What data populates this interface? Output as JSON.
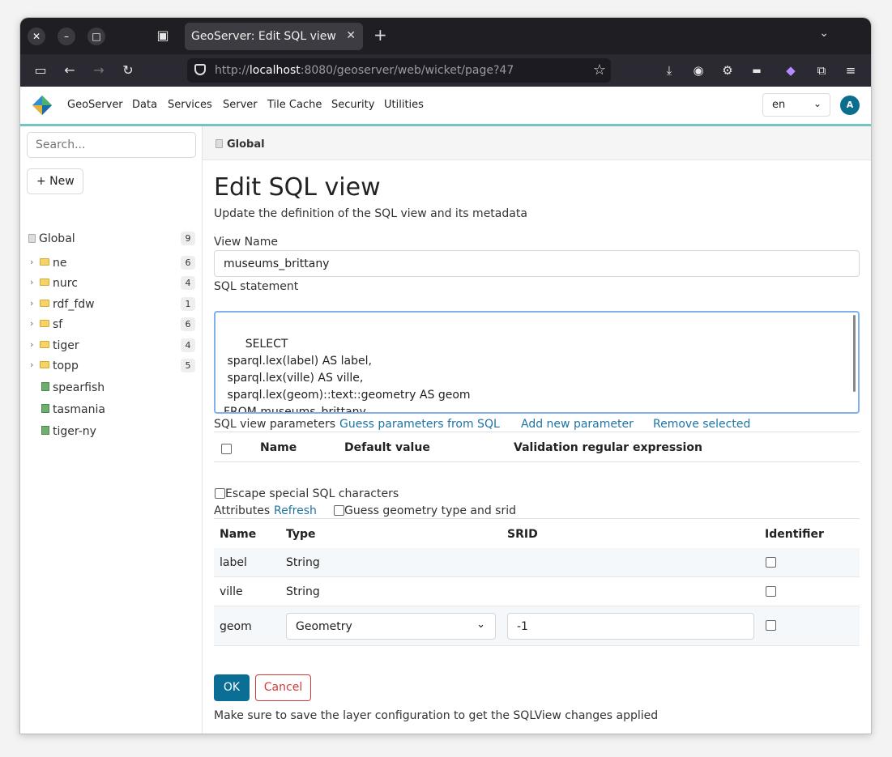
{
  "browser": {
    "tab_title": "GeoServer: Edit SQL view",
    "url_prefix": "http://",
    "url_host": "localhost",
    "url_rest": ":8080/geoserver/web/wicket/page?47"
  },
  "header": {
    "menu": [
      "GeoServer",
      "Data",
      "Services",
      "Server",
      "Tile Cache",
      "Security",
      "Utilities"
    ],
    "language": "en",
    "avatar": "A"
  },
  "sidebar": {
    "search_placeholder": "Search...",
    "new_label": "+ New",
    "root": {
      "label": "Global",
      "count": "9"
    },
    "workspaces": [
      {
        "label": "ne",
        "count": "6"
      },
      {
        "label": "nurc",
        "count": "4"
      },
      {
        "label": "rdf_fdw",
        "count": "1"
      },
      {
        "label": "sf",
        "count": "6"
      },
      {
        "label": "tiger",
        "count": "4"
      },
      {
        "label": "topp",
        "count": "5"
      }
    ],
    "layers": [
      {
        "label": "spearfish"
      },
      {
        "label": "tasmania"
      },
      {
        "label": "tiger-ny"
      }
    ]
  },
  "main": {
    "breadcrumb": "Global",
    "title": "Edit SQL view",
    "subtitle": "Update the definition of the SQL view and its metadata",
    "view_name_label": "View Name",
    "view_name": "museums_brittany",
    "sql_label": "SQL statement",
    "sql": "SELECT\n sparql.lex(label) AS label,\n sparql.lex(ville) AS ville,\n sparql.lex(geom)::text::geometry AS geom\nFROM museums_brittany",
    "params_label": "SQL view parameters",
    "guess_params": "Guess parameters from SQL",
    "add_param": "Add new parameter",
    "remove_selected": "Remove selected",
    "params_headers": {
      "name": "Name",
      "default": "Default value",
      "regex": "Validation regular expression"
    },
    "escape_label": "Escape special SQL characters",
    "attributes_label": "Attributes",
    "refresh": "Refresh",
    "guess_geom": "Guess geometry type and srid",
    "attr_headers": {
      "name": "Name",
      "type": "Type",
      "srid": "SRID",
      "identifier": "Identifier"
    },
    "attributes": [
      {
        "name": "label",
        "type": "String"
      },
      {
        "name": "ville",
        "type": "String"
      },
      {
        "name": "geom",
        "type": "Geometry",
        "srid": "-1"
      }
    ],
    "ok": "OK",
    "cancel": "Cancel",
    "note": "Make sure to save the layer configuration to get the SQLView changes applied"
  }
}
